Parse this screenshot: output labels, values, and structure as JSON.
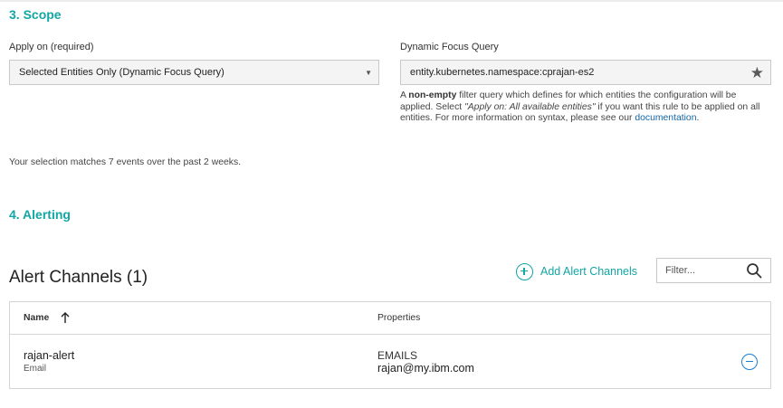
{
  "scope": {
    "title": "3. Scope",
    "apply_on_label": "Apply on (required)",
    "apply_on_value": "Selected Entities Only (Dynamic Focus Query)",
    "query_label": "Dynamic Focus Query",
    "query_value": "entity.kubernetes.namespace:cprajan-es2",
    "help_prefix": "A ",
    "help_bold": "non-empty",
    "help_mid": " filter query which defines for which entities the configuration will be applied. Select ",
    "help_italic": "\"Apply on: All available entities\"",
    "help_suffix": " if you want this rule to be applied on all entities. For more information on syntax, please see our ",
    "help_link": "documentation",
    "help_end": ".",
    "matches": "Your selection matches 7 events over the past 2 weeks."
  },
  "alerting": {
    "title": "4. Alerting",
    "channels_title": "Alert Channels (1)",
    "add_label": "Add Alert Channels",
    "filter_placeholder": "Filter...",
    "columns": {
      "name": "Name",
      "properties": "Properties"
    },
    "rows": [
      {
        "name": "rajan-alert",
        "type": "Email",
        "prop_key": "EMAILS",
        "prop_value": "rajan@my.ibm.com"
      }
    ]
  },
  "colors": {
    "accent": "#12a6a4",
    "link": "#1466a5",
    "remove": "#1a7fd0"
  },
  "icons": {
    "star": "star-icon",
    "add": "plus-circle-icon",
    "search": "search-icon",
    "sort": "arrow-up-icon",
    "remove": "minus-circle-icon",
    "caret": "caret-down-icon"
  }
}
